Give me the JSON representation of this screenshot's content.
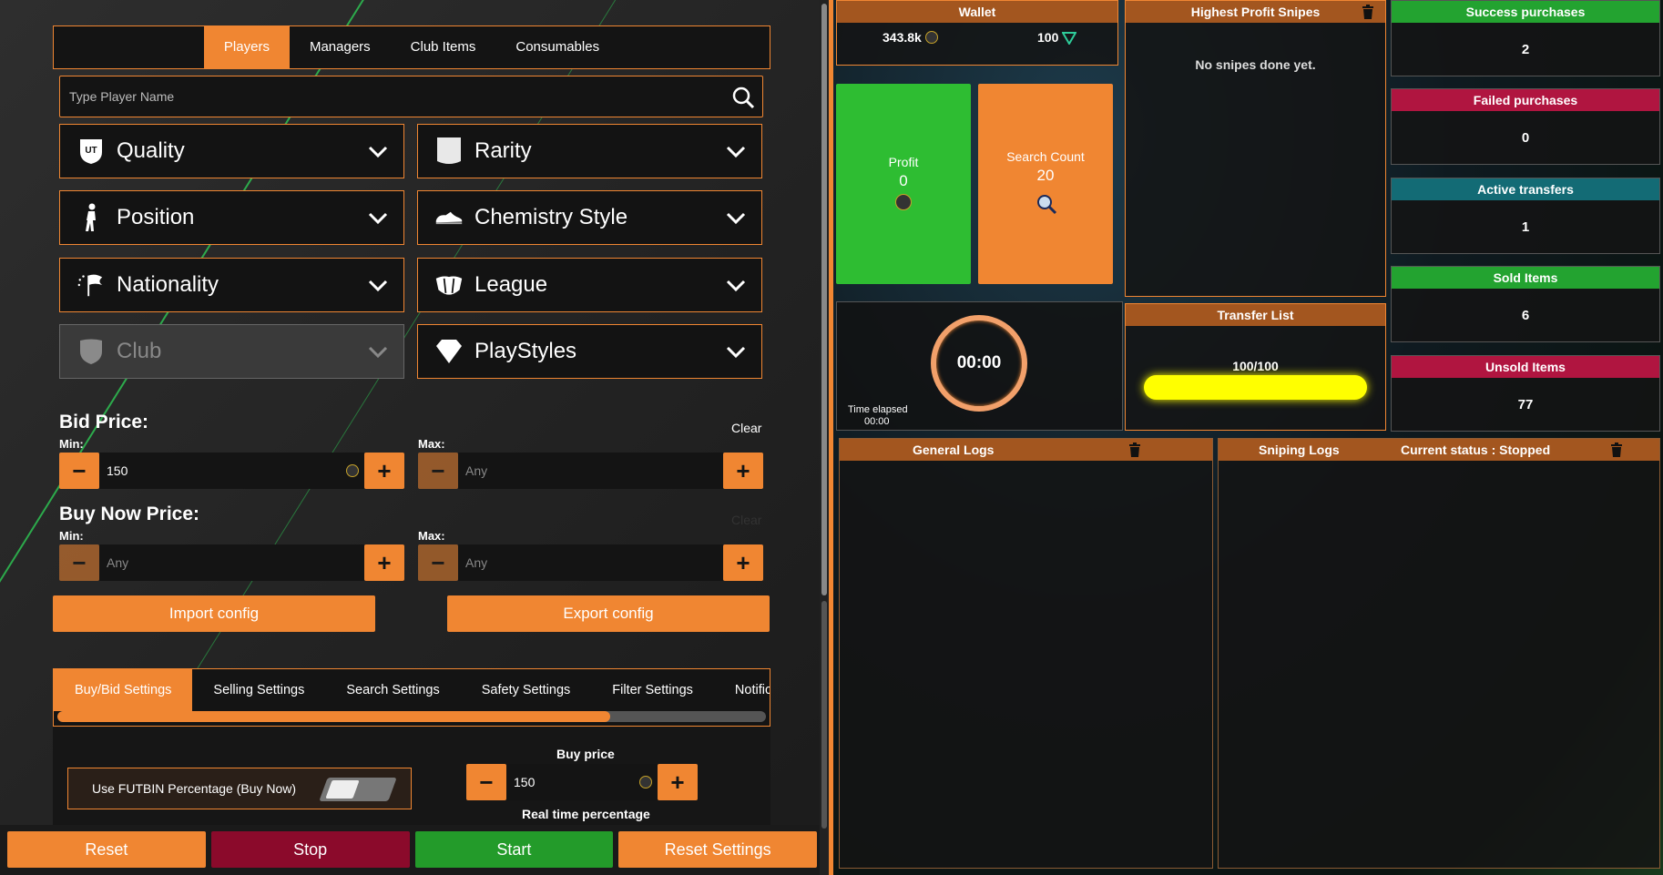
{
  "filter_tabs": [
    "Players",
    "Managers",
    "Club Items",
    "Consumables"
  ],
  "search": {
    "placeholder": "Type Player Name"
  },
  "filters": {
    "quality": "Quality",
    "rarity": "Rarity",
    "position": "Position",
    "chemistry_style": "Chemistry Style",
    "nationality": "Nationality",
    "league": "League",
    "club": "Club",
    "playstyles": "PlayStyles"
  },
  "bid_price": {
    "title": "Bid Price:",
    "clear": "Clear",
    "min_label": "Min:",
    "max_label": "Max:",
    "min_value": "150",
    "max_placeholder": "Any"
  },
  "buy_now_price": {
    "title": "Buy Now Price:",
    "clear": "Clear",
    "min_label": "Min:",
    "max_label": "Max:",
    "min_placeholder": "Any",
    "max_placeholder": "Any"
  },
  "config": {
    "import": "Import config",
    "export": "Export config"
  },
  "settings_tabs": [
    "Buy/Bid Settings",
    "Selling Settings",
    "Search Settings",
    "Safety Settings",
    "Filter Settings",
    "Notifications"
  ],
  "settings_progress": 0.78,
  "settings": {
    "futbin_toggle": "Use FUTBIN Percentage (Buy Now)",
    "buy_price_label": "Buy price",
    "buy_price_value": "150",
    "realtime_label": "Real time percentage"
  },
  "actions": {
    "reset": "Reset",
    "stop": "Stop",
    "start": "Start",
    "reset_settings": "Reset Settings"
  },
  "wallet": {
    "title": "Wallet",
    "coins": "343.8k",
    "points": "100"
  },
  "profit": {
    "label": "Profit",
    "value": "0"
  },
  "search_count": {
    "label": "Search Count",
    "value": "20"
  },
  "timer": {
    "value": "00:00",
    "elapsed_label": "Time elapsed",
    "elapsed_value": "00:00"
  },
  "highest_profit": {
    "title": "Highest Profit Snipes",
    "empty": "No snipes done yet."
  },
  "transfer_list": {
    "title": "Transfer List",
    "value": "100/100",
    "fill": 1.0
  },
  "stats": [
    {
      "label": "Success purchases",
      "value": "2",
      "color": "#23a330"
    },
    {
      "label": "Failed purchases",
      "value": "0",
      "color": "#b01540"
    },
    {
      "label": "Active transfers",
      "value": "1",
      "color": "#136b75"
    },
    {
      "label": "Sold Items",
      "value": "6",
      "color": "#23a330"
    },
    {
      "label": "Unsold Items",
      "value": "77",
      "color": "#b01540"
    }
  ],
  "logs": {
    "general": "General Logs",
    "sniping": "Sniping Logs",
    "status": "Current status : Stopped"
  },
  "colors": {
    "accent": "#f08632",
    "profit_bg": "#2ebd32",
    "stop": "#8b0a2b",
    "start": "#239b2a",
    "progress_yellow": "#ffff00"
  }
}
